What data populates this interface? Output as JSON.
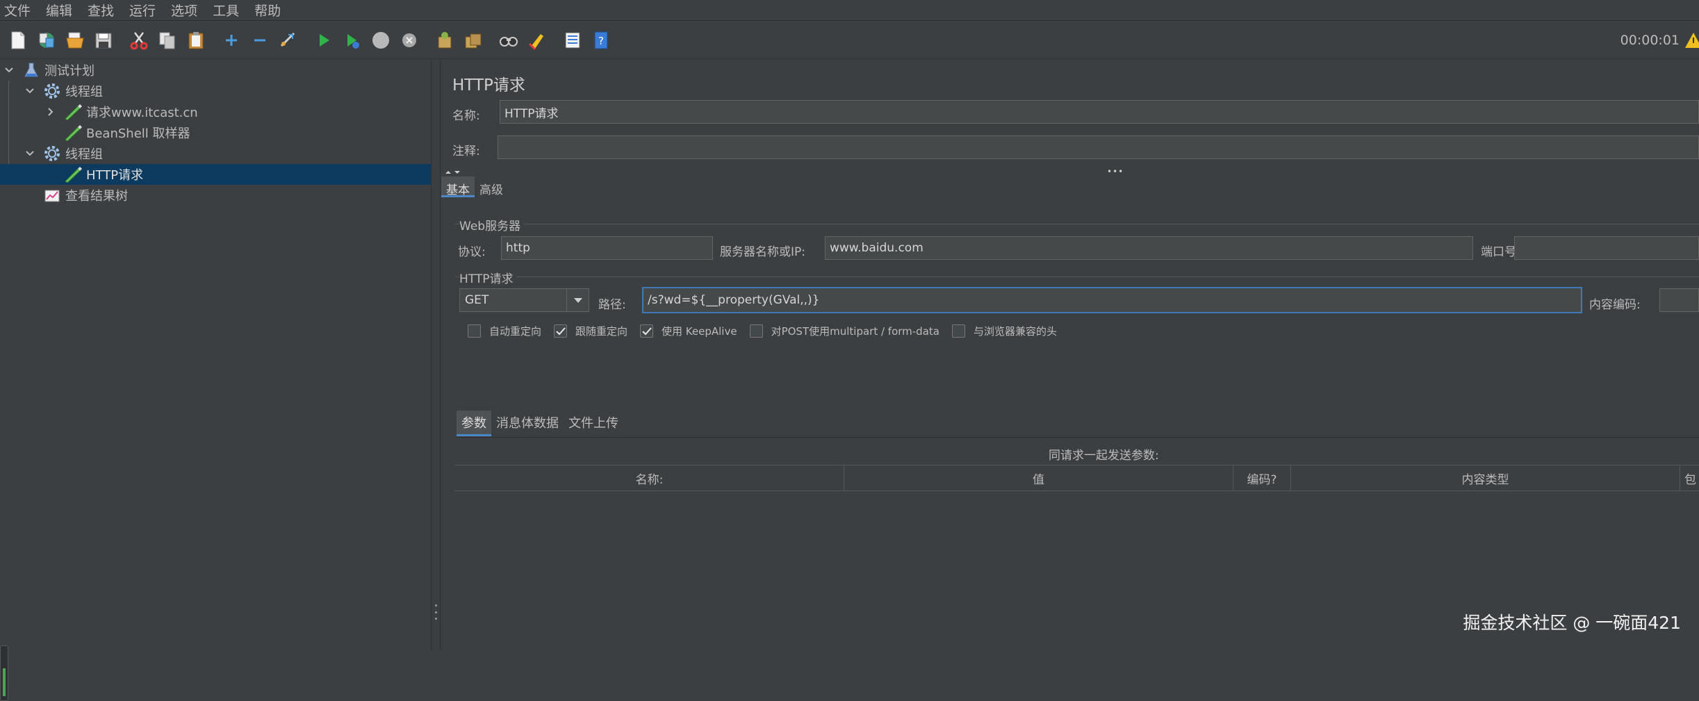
{
  "menu": [
    "文件",
    "编辑",
    "查找",
    "运行",
    "选项",
    "工具",
    "帮助"
  ],
  "toolbar": {
    "icons": [
      "new-icon",
      "templates-icon",
      "open-icon",
      "save-icon",
      "cut-icon",
      "copy-icon",
      "paste-icon",
      "expand-icon",
      "collapse-icon",
      "toggle-icon",
      "start-icon",
      "start-no-pause-icon",
      "stop-icon",
      "shutdown-icon",
      "clear-icon",
      "clear-all-icon",
      "search-icon",
      "reset-search-icon",
      "function-helper-icon",
      "help-icon"
    ],
    "timer": "00:00:01"
  },
  "tree": {
    "items": [
      {
        "label": "测试计划",
        "icon": "flask-icon"
      },
      {
        "label": "线程组",
        "icon": "gear-icon"
      },
      {
        "label": "请求www.itcast.cn",
        "icon": "sampler-pen-icon"
      },
      {
        "label": "BeanShell 取样器",
        "icon": "sampler-pen-icon"
      },
      {
        "label": "线程组",
        "icon": "gear-icon"
      },
      {
        "label": "HTTP请求",
        "icon": "sampler-pen-icon"
      },
      {
        "label": "查看结果树",
        "icon": "chart-icon"
      }
    ]
  },
  "main": {
    "title": "HTTP请求",
    "name_label": "名称:",
    "name_value": "HTTP请求",
    "comment_label": "注释:",
    "comment_value": "",
    "tabs": [
      "基本",
      "高级"
    ],
    "web_server": {
      "group_title": "Web服务器",
      "protocol_label": "协议:",
      "protocol_value": "http",
      "server_label": "服务器名称或IP:",
      "server_value": "www.baidu.com",
      "port_label": "端口号:",
      "port_value": ""
    },
    "http_request": {
      "group_title": "HTTP请求",
      "method": "GET",
      "path_label": "路径:",
      "path_value": "/s?wd=${__property(GVal,,)}",
      "encoding_label": "内容编码:",
      "encoding_value": ""
    },
    "checkboxes": [
      {
        "label": "自动重定向",
        "checked": false
      },
      {
        "label": "跟随重定向",
        "checked": true
      },
      {
        "label": "使用 KeepAlive",
        "checked": true
      },
      {
        "label": "对POST使用multipart / form-data",
        "checked": false
      },
      {
        "label": "与浏览器兼容的头",
        "checked": false
      }
    ],
    "subtabs": [
      "参数",
      "消息体数据",
      "文件上传"
    ],
    "params_caption": "同请求一起发送参数:",
    "table_headers": [
      "名称:",
      "值",
      "编码?",
      "内容类型",
      "包"
    ]
  },
  "watermark": "掘金技术社区 @ 一碗面421",
  "colors": {
    "selection": "#0d3a5f",
    "focus_border": "#3d7ab8",
    "tab_accent": "#4a88c7"
  }
}
